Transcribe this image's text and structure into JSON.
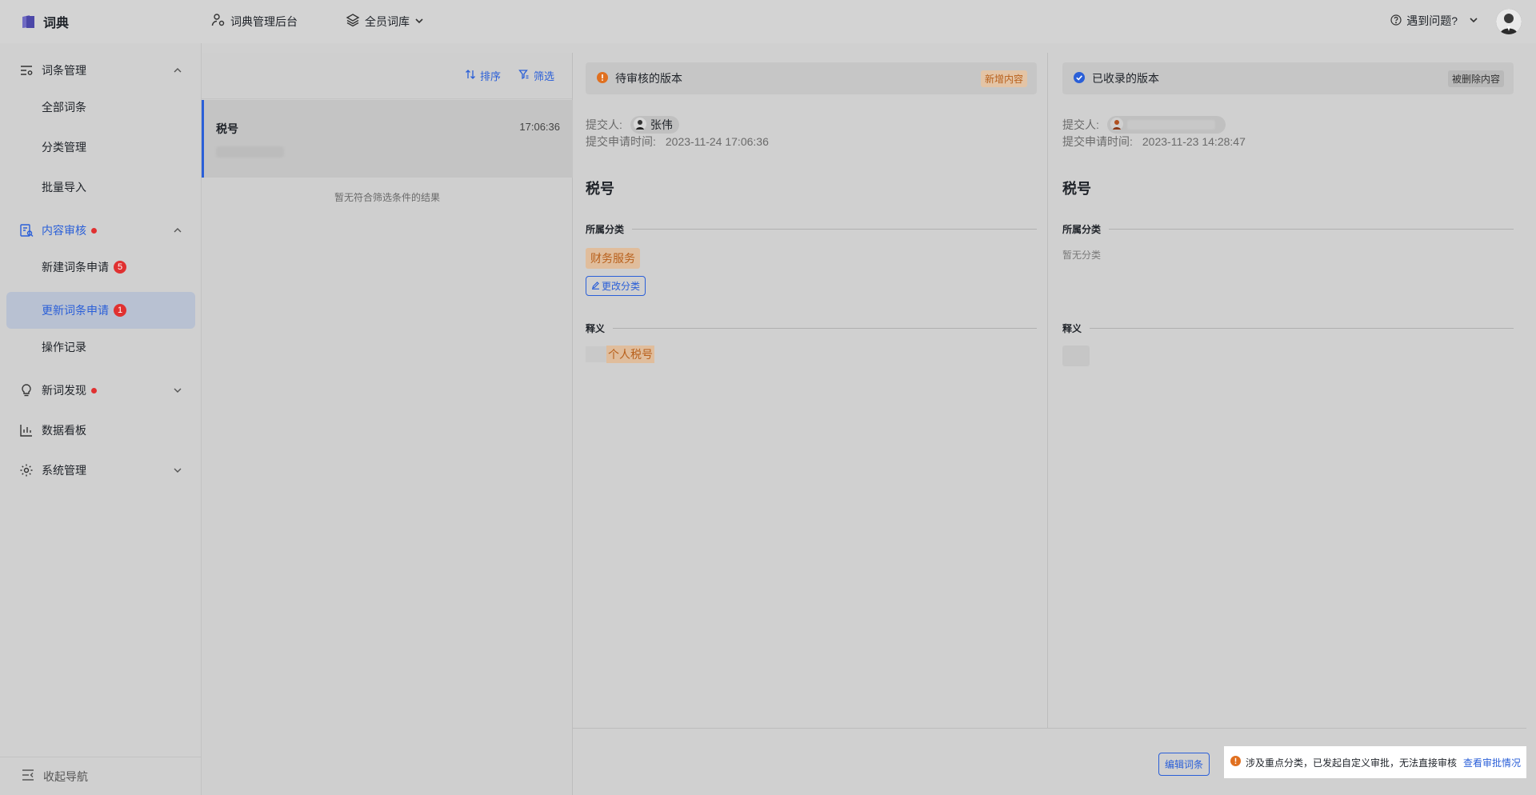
{
  "app": {
    "title": "词典"
  },
  "topnav": {
    "admin": "词典管理后台",
    "library": "全员词库",
    "help": "遇到问题?"
  },
  "sidebar": {
    "groups": [
      {
        "label": "词条管理",
        "icon": "list-settings-icon",
        "expanded": true,
        "items": [
          {
            "label": "全部词条"
          },
          {
            "label": "分类管理"
          },
          {
            "label": "批量导入"
          }
        ]
      },
      {
        "label": "内容审核",
        "icon": "review-icon",
        "expanded": true,
        "dot": true,
        "items": [
          {
            "label": "新建词条申请",
            "badge": "5"
          },
          {
            "label": "更新词条申请",
            "badge": "1",
            "active": true
          },
          {
            "label": "操作记录"
          }
        ]
      },
      {
        "label": "新词发现",
        "icon": "bulb-icon",
        "dot": true
      },
      {
        "label": "数据看板",
        "icon": "bar-chart-icon"
      },
      {
        "label": "系统管理",
        "icon": "gear-icon"
      }
    ],
    "collapse_label": "收起导航"
  },
  "list": {
    "sort_label": "排序",
    "filter_label": "筛选",
    "item": {
      "title": "税号",
      "time": "17:06:36"
    },
    "empty_text": "暂无符合筛选条件的结果"
  },
  "pending": {
    "header": "待审核的版本",
    "tag": "新增内容",
    "submitter_label": "提交人:",
    "submitter_name": "张伟",
    "time_label": "提交申请时间:",
    "time_value": "2023-11-24 17:06:36",
    "term": "税号",
    "category_label": "所属分类",
    "category_value": "财务服务",
    "change_category": "更改分类",
    "definition_label": "释义",
    "definition_value": "个人税号"
  },
  "recorded": {
    "header": "已收录的版本",
    "tag": "被删除内容",
    "submitter_label": "提交人:",
    "time_label": "提交申请时间:",
    "time_value": "2023-11-23 14:28:47",
    "term": "税号",
    "category_label": "所属分类",
    "category_empty": "暂无分类",
    "definition_label": "释义"
  },
  "footer": {
    "edit_button": "编辑词条",
    "notice_text": "涉及重点分类，已发起自定义审批，无法直接审核",
    "notice_link": "查看审批情况"
  },
  "colors": {
    "accent": "#2a5fd8",
    "warning": "#e07020",
    "badge": "#e03131"
  }
}
